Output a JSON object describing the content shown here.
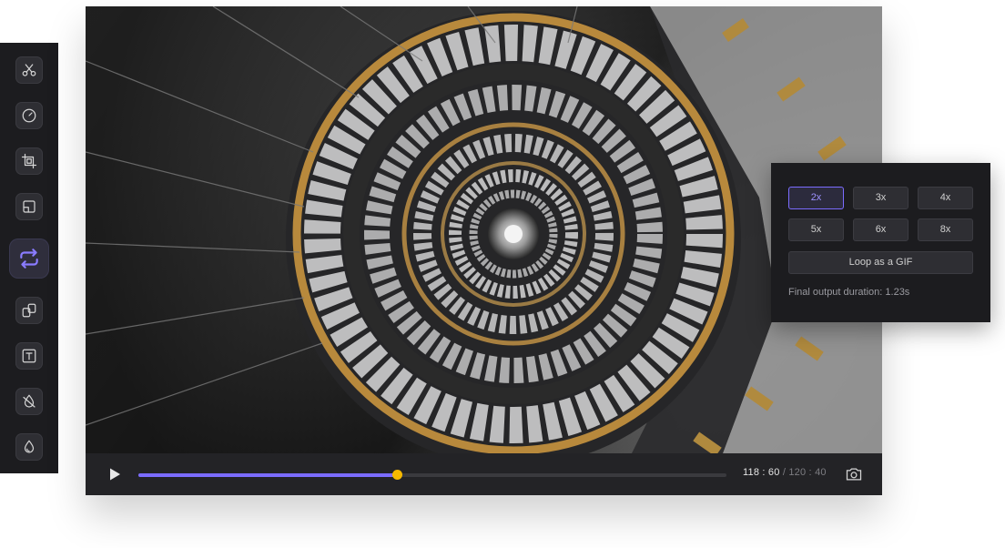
{
  "sidebar": {
    "tools": [
      {
        "name": "cut",
        "icon": "scissors-icon"
      },
      {
        "name": "speed",
        "icon": "speedometer-icon"
      },
      {
        "name": "crop",
        "icon": "crop-icon"
      },
      {
        "name": "resize",
        "icon": "resize-icon"
      },
      {
        "name": "loop",
        "icon": "loop-icon",
        "active": true
      },
      {
        "name": "merge",
        "icon": "merge-icon"
      },
      {
        "name": "text",
        "icon": "text-icon"
      },
      {
        "name": "remove-audio",
        "icon": "mute-icon"
      },
      {
        "name": "color",
        "icon": "droplet-icon"
      }
    ],
    "accent": "#8a7cff"
  },
  "player": {
    "progress": 0.44,
    "current_time": "118 : 60",
    "separator": "/",
    "total_time": "120 : 40",
    "accent": "#7b6cff",
    "thumb_color": "#f5b800"
  },
  "loop_panel": {
    "speeds": [
      {
        "label": "2x",
        "selected": true
      },
      {
        "label": "3x",
        "selected": false
      },
      {
        "label": "4x",
        "selected": false
      },
      {
        "label": "5x",
        "selected": false
      },
      {
        "label": "6x",
        "selected": false
      },
      {
        "label": "8x",
        "selected": false
      }
    ],
    "gif_label": "Loop as a GIF",
    "duration_text": "Final output duration: 1.23s"
  }
}
